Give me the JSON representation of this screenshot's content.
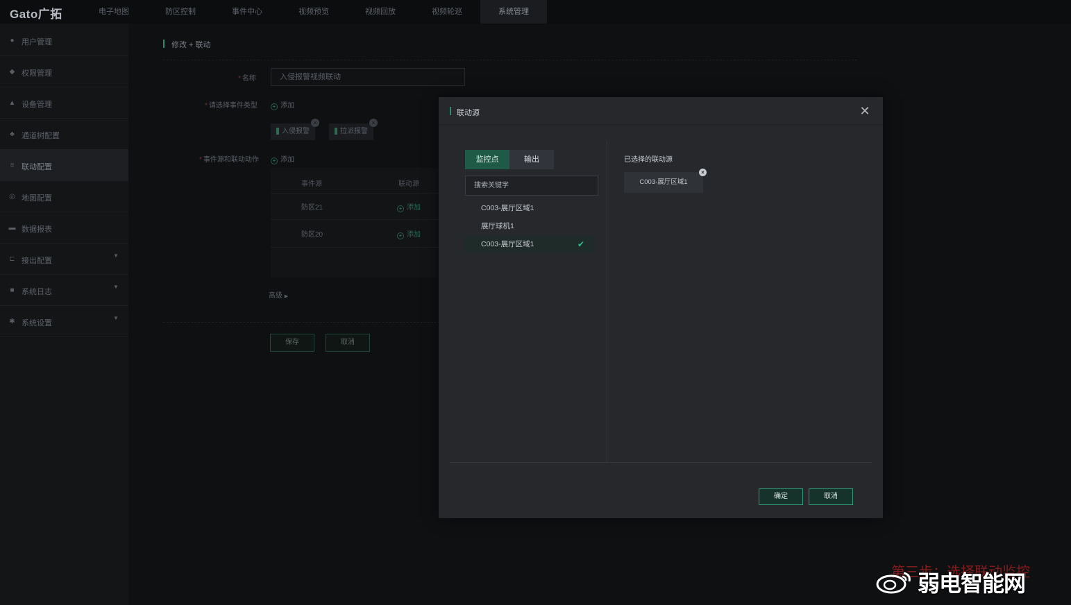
{
  "app": {
    "logo": "Gato广拓"
  },
  "topnav": [
    "电子地图",
    "防区控制",
    "事件中心",
    "视频预览",
    "视频回放",
    "视频轮巡",
    "系统管理"
  ],
  "sidebar": {
    "items": [
      {
        "label": "用户管理",
        "icon": "user-icon"
      },
      {
        "label": "权限管理",
        "icon": "shield-icon"
      },
      {
        "label": "设备管理",
        "icon": "device-icon"
      },
      {
        "label": "通道树配置",
        "icon": "tree-icon"
      },
      {
        "label": "联动配置",
        "icon": "list-icon"
      },
      {
        "label": "地图配置",
        "icon": "map-icon"
      },
      {
        "label": "数据报表",
        "icon": "report-icon"
      },
      {
        "label": "接出配置",
        "icon": "output-icon"
      },
      {
        "label": "系统日志",
        "icon": "log-icon"
      },
      {
        "label": "系统设置",
        "icon": "gear-icon"
      }
    ]
  },
  "form": {
    "heading": "修改 + 联动",
    "name_label": "名称",
    "name_value": "入侵报警视频联动",
    "event_type_label": "请选择事件类型",
    "add": "添加",
    "event_tags": [
      "入侵报警",
      "拉派报警"
    ],
    "event_action_label": "事件源和联动动作",
    "table": {
      "headers": [
        "事件源",
        "联动源"
      ],
      "rows": [
        {
          "source": "防区21",
          "action": "添加"
        },
        {
          "source": "防区20",
          "action": "添加"
        }
      ]
    },
    "advanced": "高级",
    "save": "保存",
    "cancel": "取消"
  },
  "modal": {
    "title": "联动源",
    "tabs": [
      "监控点",
      "输出"
    ],
    "search_placeholder": "搜索关键字",
    "items": [
      "C003-展厅区域1",
      "展厅球机1",
      "C003-展厅区域1"
    ],
    "selected_title": "已选择的联动源",
    "selected_chip": "C003-展厅区域1",
    "ok": "确定",
    "cancel": "取消"
  },
  "watermark": {
    "text": "弱电智能网",
    "overlay": "第三步：选择联动监控"
  }
}
